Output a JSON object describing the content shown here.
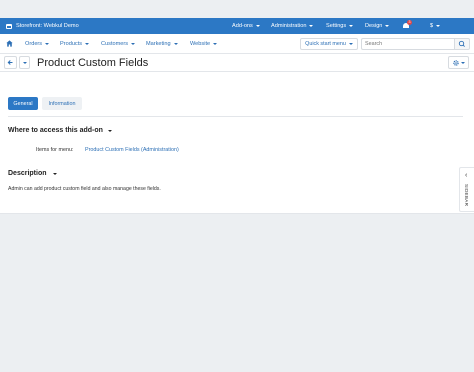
{
  "topbar": {
    "brand": "Storefront: Webkul Demo",
    "menus": [
      {
        "label": "Add-ons"
      },
      {
        "label": "Administration"
      },
      {
        "label": "Settings"
      },
      {
        "label": "Design"
      }
    ],
    "notification_count": "3",
    "currency": "$"
  },
  "nav": {
    "items": [
      {
        "label": "Orders"
      },
      {
        "label": "Products"
      },
      {
        "label": "Customers"
      },
      {
        "label": "Marketing"
      },
      {
        "label": "Website"
      }
    ],
    "quick_start": "Quick start menu",
    "search_placeholder": "Search"
  },
  "page": {
    "title": "Product Custom Fields"
  },
  "tabs": [
    {
      "label": "General",
      "active": true
    },
    {
      "label": "Information",
      "active": false
    }
  ],
  "access": {
    "heading": "Where to access this add-on",
    "field_label": "Items for menu:",
    "field_value": "Product Custom Fields (Administration)"
  },
  "description": {
    "heading": "Description",
    "text": "Admin can add product custom field and also manage these fields."
  },
  "sidebar": {
    "label": "SIDEBAR"
  },
  "colors": {
    "topbar": "#2c78c5",
    "link": "#2c6fb5",
    "background": "#eceff2"
  },
  "icons": [
    "store-icon",
    "bell-icon",
    "home-icon",
    "search-icon",
    "back-arrow-icon",
    "gear-icon",
    "chevron-left-icon"
  ]
}
